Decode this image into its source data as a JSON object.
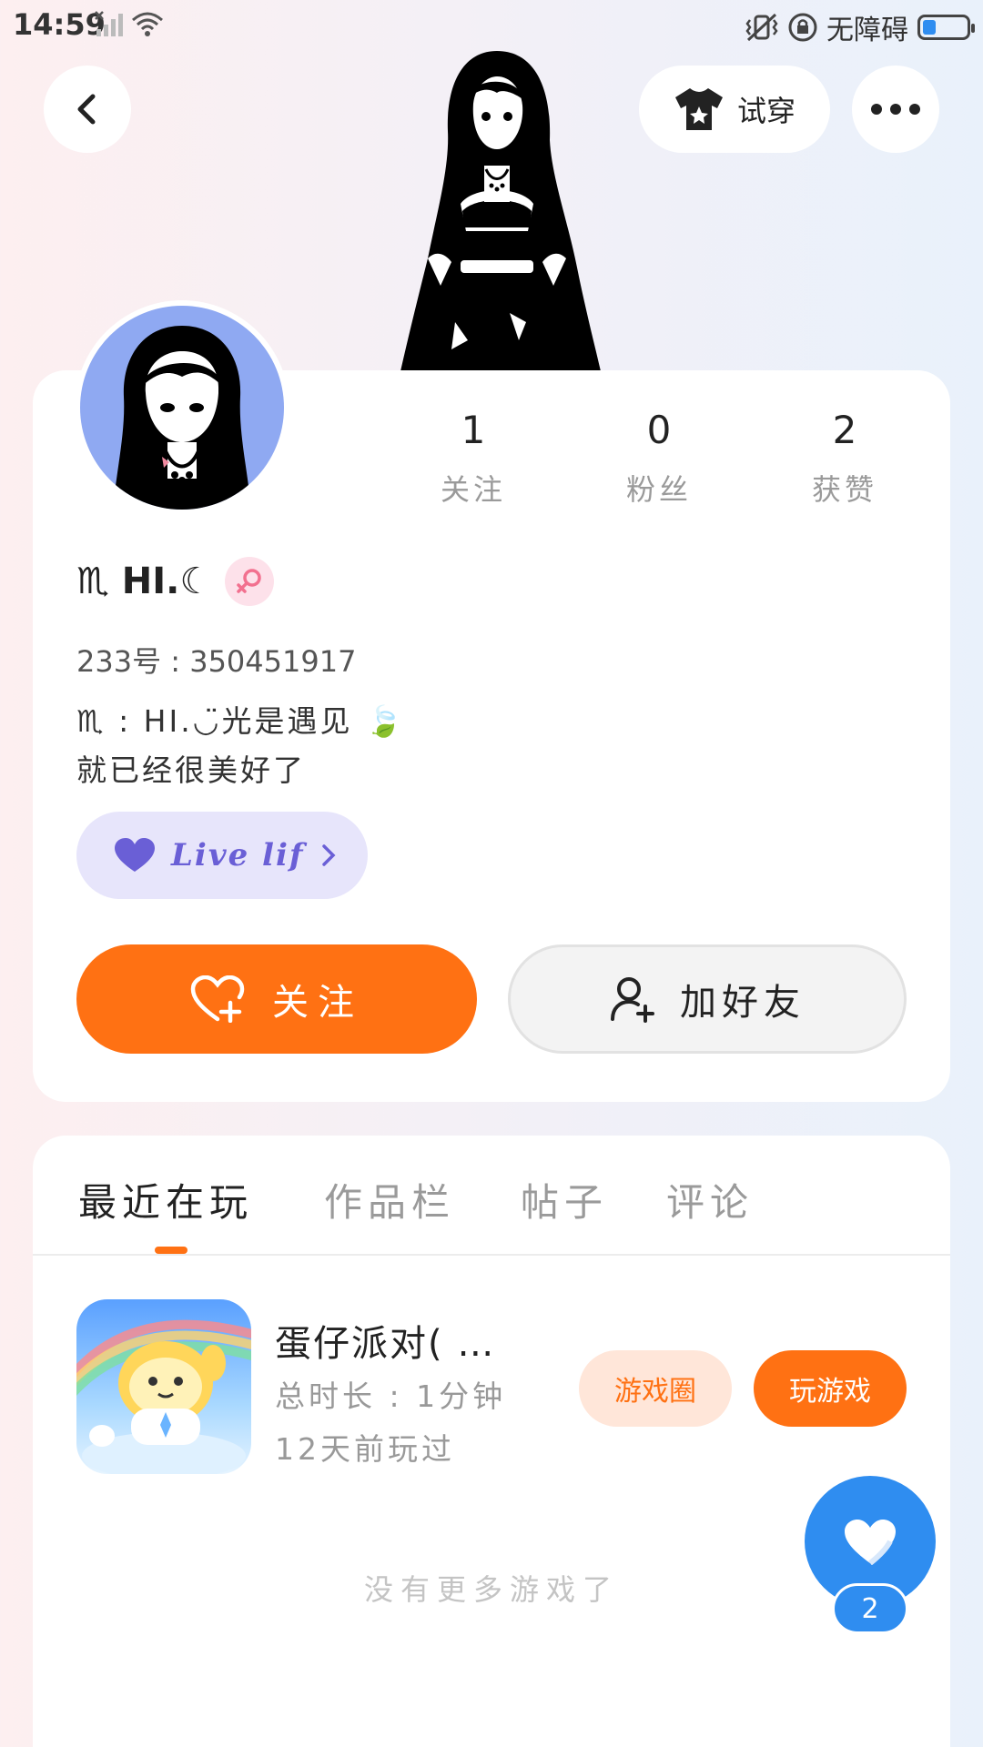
{
  "status_bar": {
    "time": "14:59",
    "accessibility": "无障碍",
    "battery_level": 0.3
  },
  "top_nav": {
    "back_icon": "chevron-left-icon",
    "tryon_label": "试穿",
    "tryon_icon": "shirt-icon",
    "more_icon": "more-dots-icon"
  },
  "profile": {
    "stats": [
      {
        "value": "1",
        "label": "关注"
      },
      {
        "value": "0",
        "label": "粉丝"
      },
      {
        "value": "2",
        "label": "获赞"
      }
    ],
    "nickname": "♏ HI.☾",
    "gender": "female",
    "uid": "233号 : 350451917",
    "bio_line1": "♏ : HI.◡̈光是遇见 🍃",
    "bio_line2": "就已经很美好了",
    "tag_label": "Live lif",
    "follow_label": "关注",
    "add_friend_label": "加好友"
  },
  "tabs": [
    {
      "label": "最近在玩",
      "active": true
    },
    {
      "label": "作品栏",
      "active": false
    },
    {
      "label": "帖子",
      "active": false
    },
    {
      "label": "评论",
      "active": false
    }
  ],
  "games": [
    {
      "title": "蛋仔派对( …",
      "total_time": "总时长 : 1分钟",
      "last_played": "12天前玩过",
      "circle_label": "游戏圈",
      "play_label": "玩游戏"
    }
  ],
  "no_more_label": "没有更多游戏了",
  "like": {
    "count": "2",
    "colors": {
      "accent": "#2f8df0"
    }
  },
  "theme": {
    "primary": "#ff7113",
    "tag_purple": "#6a5fd6"
  }
}
